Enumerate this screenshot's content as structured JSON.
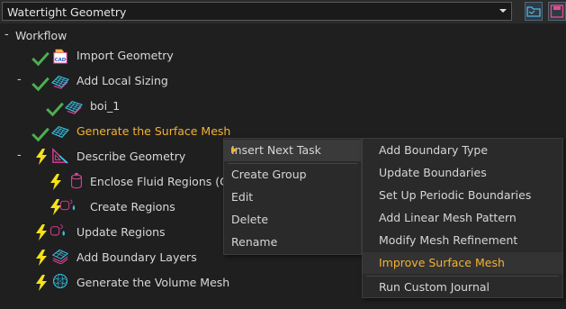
{
  "header": {
    "workflow_select": "Watertight Geometry"
  },
  "tree": {
    "root_label": "Workflow",
    "items": [
      {
        "label": "Import Geometry"
      },
      {
        "label": "Add Local Sizing"
      },
      {
        "label": "boi_1"
      },
      {
        "label": "Generate the Surface Mesh"
      },
      {
        "label": "Describe Geometry"
      },
      {
        "label": "Enclose Fluid Regions (C"
      },
      {
        "label": "Create Regions"
      },
      {
        "label": "Update Regions"
      },
      {
        "label": "Add Boundary Layers"
      },
      {
        "label": "Generate the Volume Mesh"
      }
    ]
  },
  "context_menu": {
    "items": [
      "Insert Next Task",
      "Create Group",
      "Edit",
      "Delete",
      "Rename"
    ]
  },
  "submenu": {
    "items": [
      "Add Boundary Type",
      "Update Boundaries",
      "Set Up Periodic Boundaries",
      "Add Linear Mesh Pattern",
      "Modify Mesh Refinement",
      "Improve Surface Mesh",
      "Run Custom Journal"
    ]
  },
  "icons": {
    "import": "cad-import-icon",
    "sizing": "mesh-grid-icon",
    "check": "check-icon",
    "lightning": "lightning-icon",
    "describe": "triangle-ruler-icon",
    "enclose": "cylinder-icon",
    "regions": "regions-icon",
    "boundary_layers": "layers-icon",
    "volume": "sphere-mesh-icon"
  },
  "colors": {
    "check": "#4caf50",
    "lightning": "#f5e11a",
    "active_text": "#f4b233",
    "icon_pink": "#e0409a",
    "icon_cyan": "#39c3e6"
  }
}
